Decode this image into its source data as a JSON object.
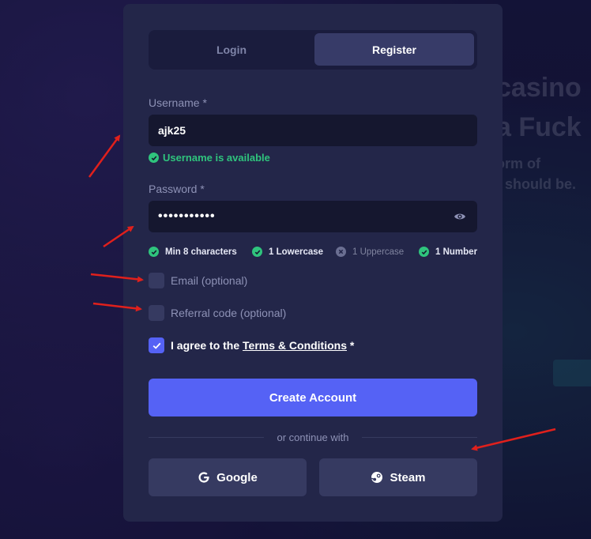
{
  "background": {
    "headline_1": "casino",
    "headline_2": "a Fuck",
    "sub_1": "orm of",
    "sub_2": "t should be."
  },
  "tabs": [
    {
      "label": "Login",
      "active": false
    },
    {
      "label": "Register",
      "active": true
    }
  ],
  "username": {
    "label": "Username *",
    "value": "ajk25",
    "status": "Username is available",
    "status_color": "#2fc47d"
  },
  "password": {
    "label": "Password *",
    "value": "•••••••••••",
    "toggle_icon": "eye-icon"
  },
  "requirements": [
    {
      "label": "Min 8 characters",
      "met": true
    },
    {
      "label": "1 Lowercase",
      "met": true
    },
    {
      "label": "1 Uppercase",
      "met": false
    },
    {
      "label": "1 Number",
      "met": true
    }
  ],
  "optional": {
    "email_label": "Email (optional)",
    "referral_label": "Referral code (optional)"
  },
  "agree": {
    "prefix": "I agree to the ",
    "link": "Terms & Conditions",
    "suffix": " *",
    "checked": true
  },
  "primary_button": "Create Account",
  "divider_text": "or continue with",
  "social": {
    "google": "Google",
    "steam": "Steam"
  },
  "colors": {
    "accent": "#5562f5",
    "card": "#232649",
    "success": "#2fc47d",
    "annotation_arrow": "#e0201c"
  }
}
